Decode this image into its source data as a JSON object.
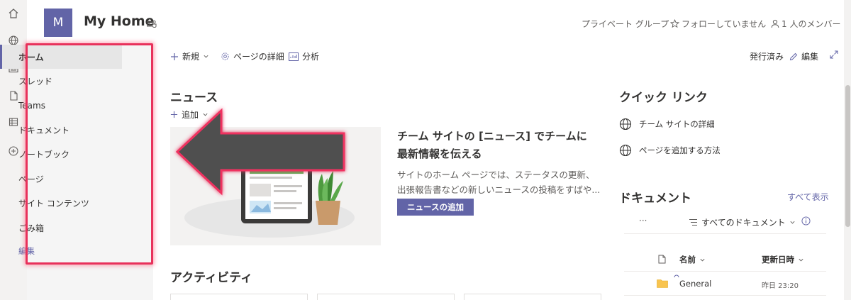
{
  "app_rail": {
    "icons": [
      "home-icon",
      "globe-icon",
      "news-icon",
      "document-icon",
      "list-icon",
      "add-circle-icon"
    ]
  },
  "site": {
    "logo_letter": "M",
    "title": "My Home",
    "privacy": "プライベート グループ",
    "follow": "フォローしていません",
    "members": "1 人のメンバー"
  },
  "nav": {
    "items": [
      "ホーム",
      "スレッド",
      "Teams",
      "ドキュメント",
      "ノートブック",
      "ページ",
      "サイト コンテンツ",
      "ごみ箱"
    ],
    "active_index": 0,
    "edit_label": "編集"
  },
  "commandbar": {
    "new_label": "新規",
    "page_details_label": "ページの詳細",
    "analytics_label": "分析",
    "published_label": "発行済み",
    "edit_label": "編集"
  },
  "news": {
    "title": "ニュース",
    "add_label": "追加",
    "headline_line1": "チーム サイトの [ニュース] でチームに",
    "headline_line2": "最新情報を伝える",
    "body_line1": "サイトのホーム ページでは、ステータスの更新、",
    "body_line2": "出張報告書などの新しいニュースの投稿をすばや...",
    "button_label": "ニュースの追加"
  },
  "activity": {
    "title": "アクティビティ"
  },
  "quick_links": {
    "title": "クイック リンク",
    "items": [
      "チーム サイトの詳細",
      "ページを追加する方法"
    ]
  },
  "documents": {
    "title": "ドキュメント",
    "show_all": "すべて表示",
    "more": "···",
    "view_label": "すべてのドキュメント",
    "col_name": "名前",
    "col_modified": "更新日時",
    "rows": [
      {
        "name": "General",
        "modified": "昨日 23:20"
      }
    ]
  },
  "colors": {
    "accent": "#6264a7",
    "highlight": "#e8315b",
    "arrow": "#505050"
  }
}
